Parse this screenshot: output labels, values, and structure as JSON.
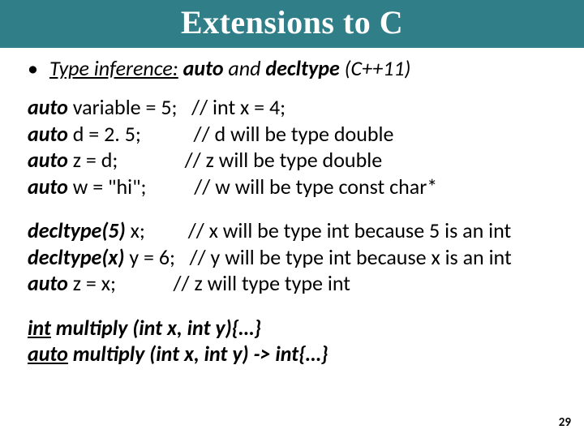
{
  "title": "Extensions to C",
  "bullet": {
    "pre": "Type inference:",
    "kw1": "auto",
    "mid": "  and ",
    "kw2": "decltype",
    "post": " (C++11)"
  },
  "b1": {
    "r1a": "auto",
    "r1b": " variable = 5;   ",
    "r1c": "// int x = 4;",
    "r2a": "auto",
    "r2b": " d = 2. 5;           ",
    "r2c": "// d will be type double",
    "r3a": "auto",
    "r3b": " z = d;              ",
    "r3c": "// z will be type double",
    "r4a": "auto",
    "r4b": " w = \"hi\";          ",
    "r4c": "// w will be type const char*"
  },
  "b2": {
    "r1a": "decltype(5)",
    "r1b": " x;         ",
    "r1c": "// x will be type int because 5 is an int",
    "r2a": "decltype(x)",
    "r2b": " y = 6;   ",
    "r2c": "// y will be type int because x is an int",
    "r3a": "auto",
    "r3b": " z = x;            ",
    "r3c": "// z will type type int"
  },
  "sigs": {
    "s1a": "int",
    "s1b": " multiply (int x, int y){…}",
    "s2a": "auto",
    "s2b": " multiply (int x, int y) -> int{…}"
  },
  "page": "29"
}
